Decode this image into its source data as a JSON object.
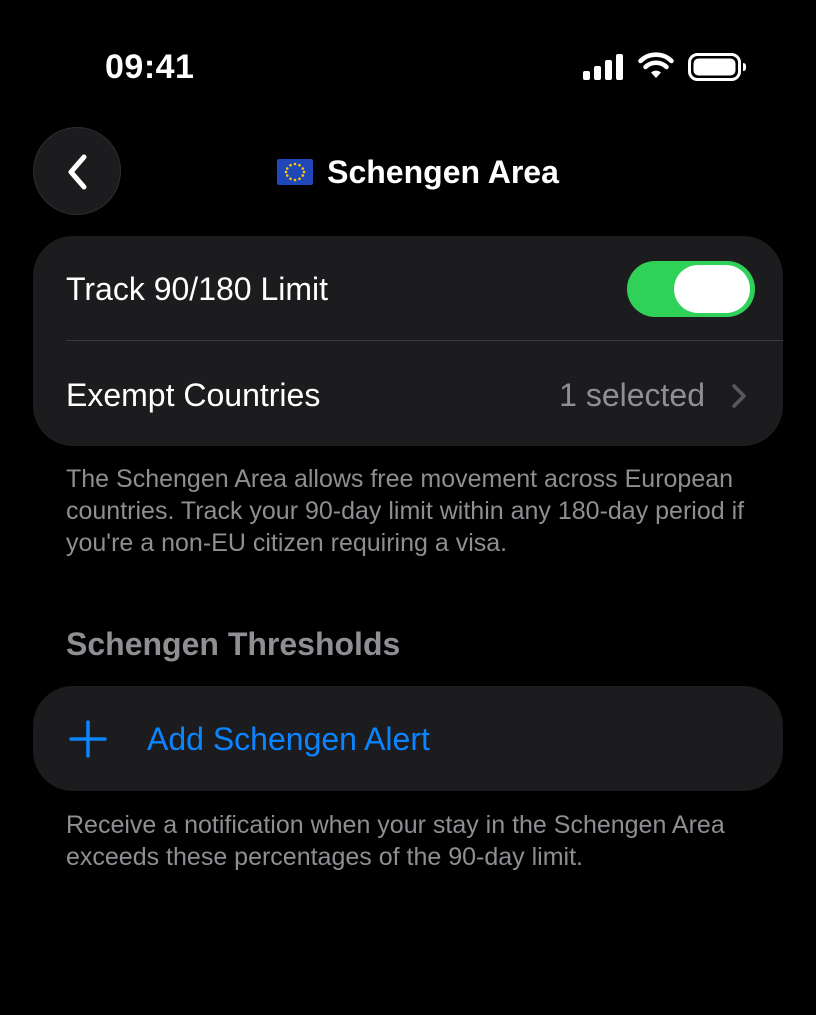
{
  "status_bar": {
    "time": "09:41",
    "icons": [
      "signal-icon",
      "wifi-icon",
      "battery-icon"
    ]
  },
  "nav": {
    "back_icon": "chevron-left-icon",
    "flag_icon": "eu-flag-icon",
    "title": "Schengen Area"
  },
  "settings": {
    "track_label": "Track 90/180 Limit",
    "track_enabled": true,
    "exempt_label": "Exempt Countries",
    "exempt_value": "1 selected"
  },
  "description": "The Schengen Area allows free movement across European countries. Track your 90-day limit within any 180-day period if you're a non-EU citizen requiring a visa.",
  "thresholds": {
    "header": "Schengen Thresholds",
    "add_label": "Add Schengen Alert",
    "footnote": "Receive a notification when your stay in the Schengen Area exceeds these percentages of the 90-day limit."
  },
  "colors": {
    "background": "#000000",
    "card": "#1c1c1e",
    "toggle_on": "#30d158",
    "accent": "#0a84ff",
    "secondary_text": "#8e8e93"
  }
}
